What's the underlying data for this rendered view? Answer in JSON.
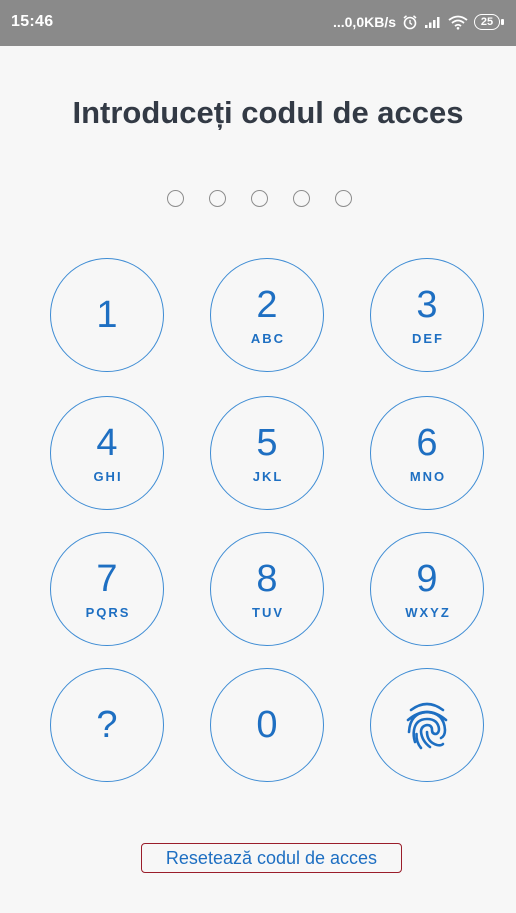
{
  "status_bar": {
    "time": "15:46",
    "network_speed": "...0,0KB/s",
    "battery_level": "25",
    "icons": [
      "alarm-icon",
      "signal-icon",
      "wifi-icon",
      "battery-icon"
    ]
  },
  "title": "Introduceți codul de acces",
  "passcode": {
    "length": 5,
    "entered": 0
  },
  "keypad": {
    "keys": [
      {
        "digit": "1",
        "letters": ""
      },
      {
        "digit": "2",
        "letters": "ABC"
      },
      {
        "digit": "3",
        "letters": "DEF"
      },
      {
        "digit": "4",
        "letters": "GHI"
      },
      {
        "digit": "5",
        "letters": "JKL"
      },
      {
        "digit": "6",
        "letters": "MNO"
      },
      {
        "digit": "7",
        "letters": "PQRS"
      },
      {
        "digit": "8",
        "letters": "TUV"
      },
      {
        "digit": "9",
        "letters": "WXYZ"
      },
      {
        "digit": "?",
        "letters": ""
      },
      {
        "digit": "0",
        "letters": ""
      }
    ],
    "fingerprint_icon": "fingerprint-icon"
  },
  "reset_link": "Resetează codul de acces",
  "colors": {
    "accent": "#1e6fc2",
    "key_border": "#3e8cd4",
    "title": "#333a45",
    "highlight_border": "#9a1d2a",
    "status_bar": "#8a8a8a"
  }
}
